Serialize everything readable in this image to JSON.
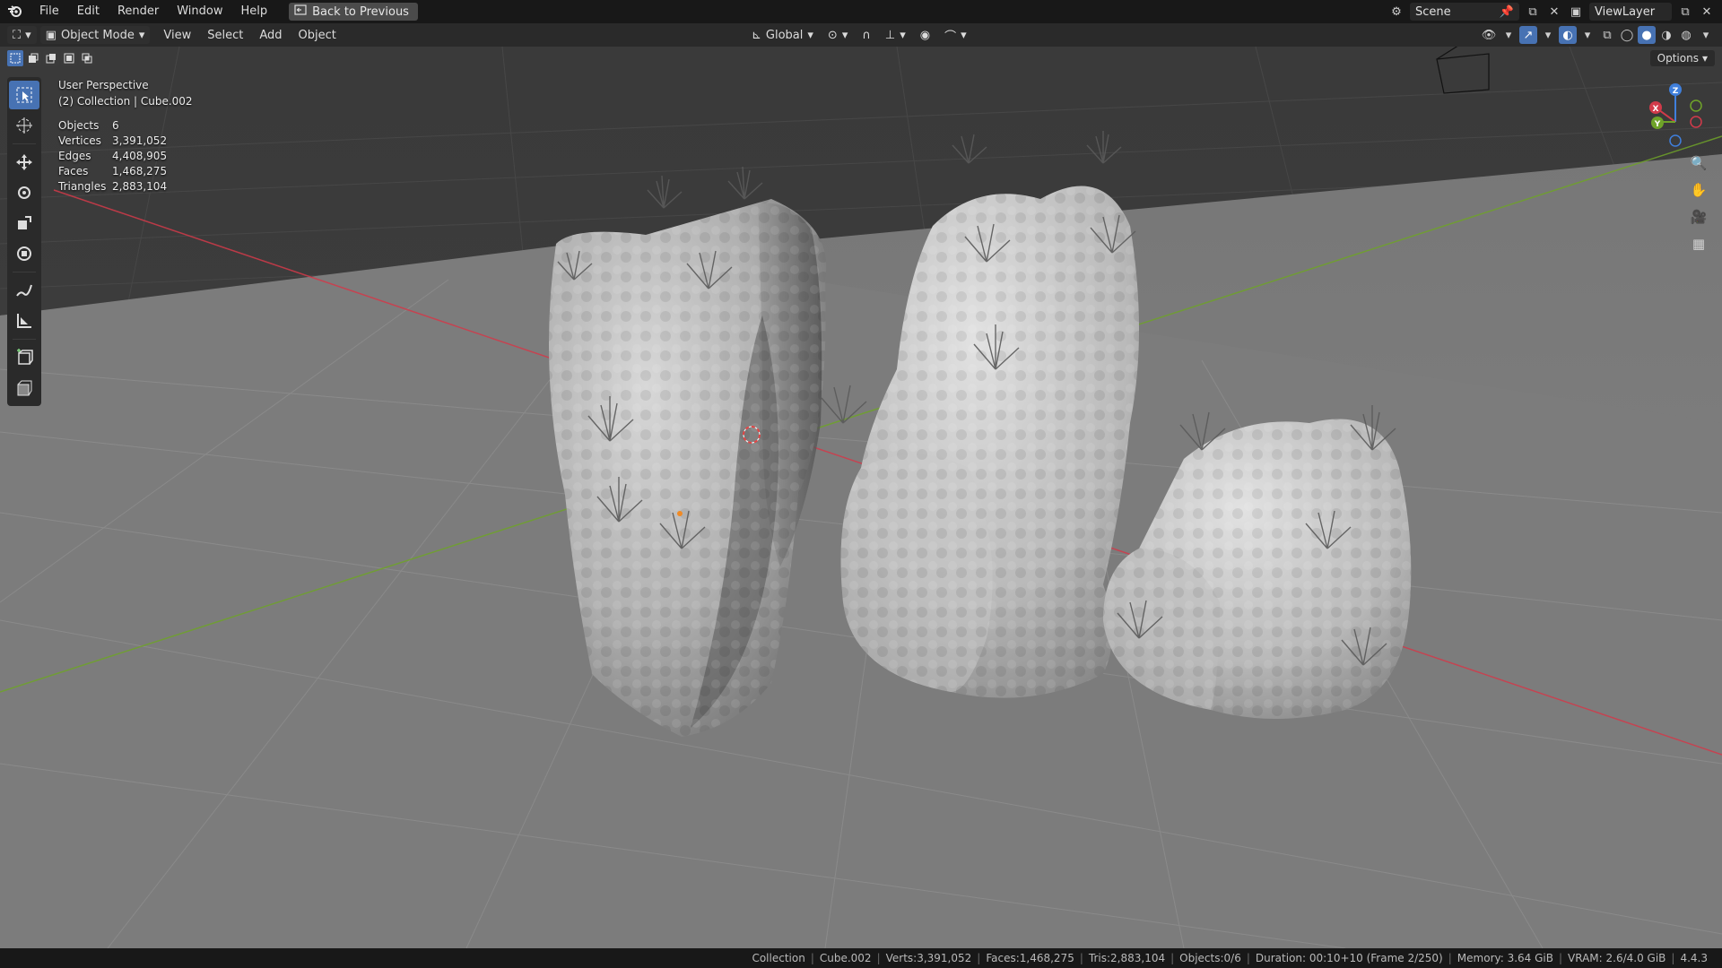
{
  "menu": {
    "logo_icon": "blender-logo-icon",
    "items": [
      "File",
      "Edit",
      "Render",
      "Window",
      "Help"
    ],
    "back_label": "Back to Previous"
  },
  "topright": {
    "scene_label": "Scene",
    "viewlayer_label": "ViewLayer"
  },
  "viewport_header": {
    "mode_label": "Object Mode",
    "menus": [
      "View",
      "Select",
      "Add",
      "Object"
    ],
    "transform_orientation": "Global",
    "options_label": "Options"
  },
  "overlay": {
    "view_name": "User Perspective",
    "collection_line": "(2) Collection | Cube.002",
    "stats": [
      {
        "label": "Objects",
        "value": "6"
      },
      {
        "label": "Vertices",
        "value": "3,391,052"
      },
      {
        "label": "Edges",
        "value": "4,408,905"
      },
      {
        "label": "Faces",
        "value": "1,468,275"
      },
      {
        "label": "Triangles",
        "value": "2,883,104"
      }
    ]
  },
  "gizmo": {
    "x_label": "X",
    "y_label": "Y",
    "z_label": "Z"
  },
  "colors": {
    "accent": "#4772b3",
    "x_axis": "#d23a4a",
    "y_axis": "#6fa329",
    "z_axis": "#3f7fdc",
    "grid": "#545454",
    "floor": "#7c7c7c"
  },
  "status": {
    "items": [
      "Collection",
      "Cube.002",
      "Verts:3,391,052",
      "Faces:1,468,275",
      "Tris:2,883,104",
      "Objects:0/6",
      "Duration: 00:10+10 (Frame 2/250)",
      "Memory: 3.64 GiB",
      "VRAM: 2.6/4.0 GiB",
      "4.4.3"
    ]
  }
}
